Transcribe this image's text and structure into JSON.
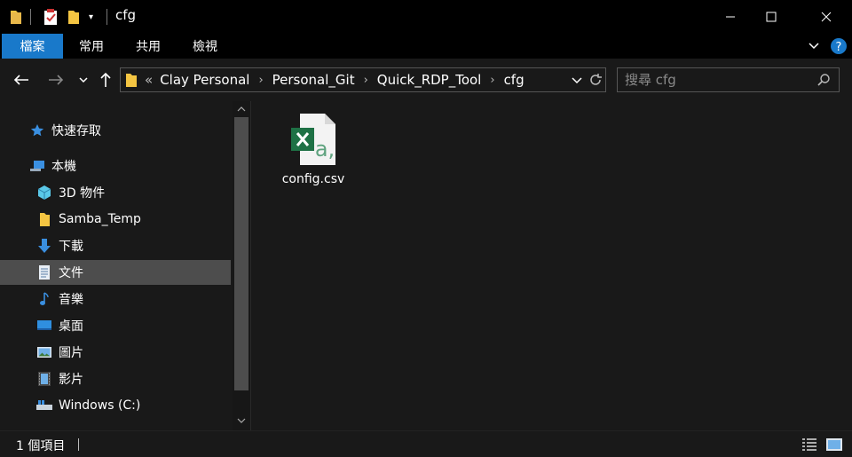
{
  "window": {
    "title": "cfg",
    "controls": {
      "minimize": "minimize-icon",
      "maximize": "maximize-icon",
      "close": "close-icon"
    }
  },
  "ribbon": {
    "tabs": [
      {
        "label": "檔案",
        "active": true
      },
      {
        "label": "常用"
      },
      {
        "label": "共用"
      },
      {
        "label": "檢視"
      }
    ]
  },
  "address": {
    "overflow": "«",
    "crumbs": [
      "Clay Personal",
      "Personal_Git",
      "Quick_RDP_Tool",
      "cfg"
    ]
  },
  "search": {
    "placeholder": "搜尋 cfg",
    "value": ""
  },
  "sidebar": {
    "items": [
      {
        "label": "快速存取",
        "icon": "star-icon"
      },
      {
        "label": "本機",
        "icon": "computer-icon"
      },
      {
        "label": "3D 物件",
        "icon": "cube-icon"
      },
      {
        "label": "Samba_Temp",
        "icon": "folder-icon"
      },
      {
        "label": "下載",
        "icon": "download-icon"
      },
      {
        "label": "文件",
        "icon": "document-icon",
        "selected": true
      },
      {
        "label": "音樂",
        "icon": "music-icon"
      },
      {
        "label": "桌面",
        "icon": "desktop-icon"
      },
      {
        "label": "圖片",
        "icon": "pictures-icon"
      },
      {
        "label": "影片",
        "icon": "video-icon"
      },
      {
        "label": "Windows (C:)",
        "icon": "drive-icon"
      }
    ]
  },
  "files": [
    {
      "name": "config.csv",
      "icon": "excel-csv-icon"
    }
  ],
  "status": {
    "count": "1 個項目"
  },
  "colors": {
    "accent": "#1979ca",
    "background": "#191919",
    "selected": "#4d4d4d",
    "excel": "#1e7145"
  }
}
